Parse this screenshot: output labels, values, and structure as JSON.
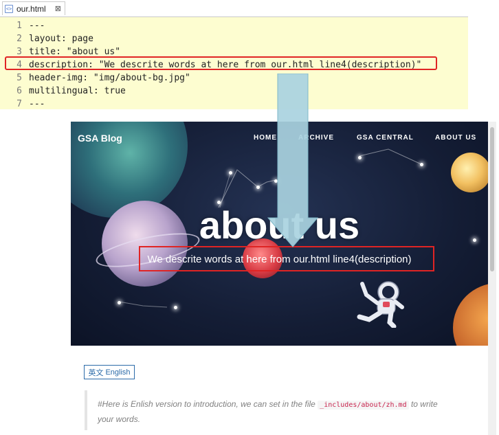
{
  "editor": {
    "tab_label": "our.html",
    "tab_close": "⊠",
    "file_icon": "<>",
    "lines": [
      {
        "num": "1",
        "text": "---"
      },
      {
        "num": "2",
        "text": "layout: page"
      },
      {
        "num": "3",
        "text": "title: \"about us\""
      },
      {
        "num": "4",
        "text": "description: \"We descrite words at here from our.html line4(description)\""
      },
      {
        "num": "5",
        "text": "header-img: \"img/about-bg.jpg\""
      },
      {
        "num": "6",
        "text": "multilingual: true"
      },
      {
        "num": "7",
        "text": "---"
      }
    ],
    "highlight_color": "#e02424"
  },
  "preview": {
    "brand": "GSA Blog",
    "nav": [
      "HOME",
      "ARCHIVE",
      "GSA CENTRAL",
      "ABOUT US"
    ],
    "hero_title": "about us",
    "hero_description": "We descrite words at here from our.html line4(description)"
  },
  "content": {
    "lang_icon": "英文",
    "lang_button": "English",
    "intro_before": "#Here is Enlish version to introduction, we can set in the file ",
    "intro_code": "_includes/about/zh.md",
    "intro_after": " to write your words."
  },
  "colors": {
    "editor_bg": "#fdfdd0",
    "arrow_fill": "#a9d3df",
    "link": "#2a6aa8"
  }
}
